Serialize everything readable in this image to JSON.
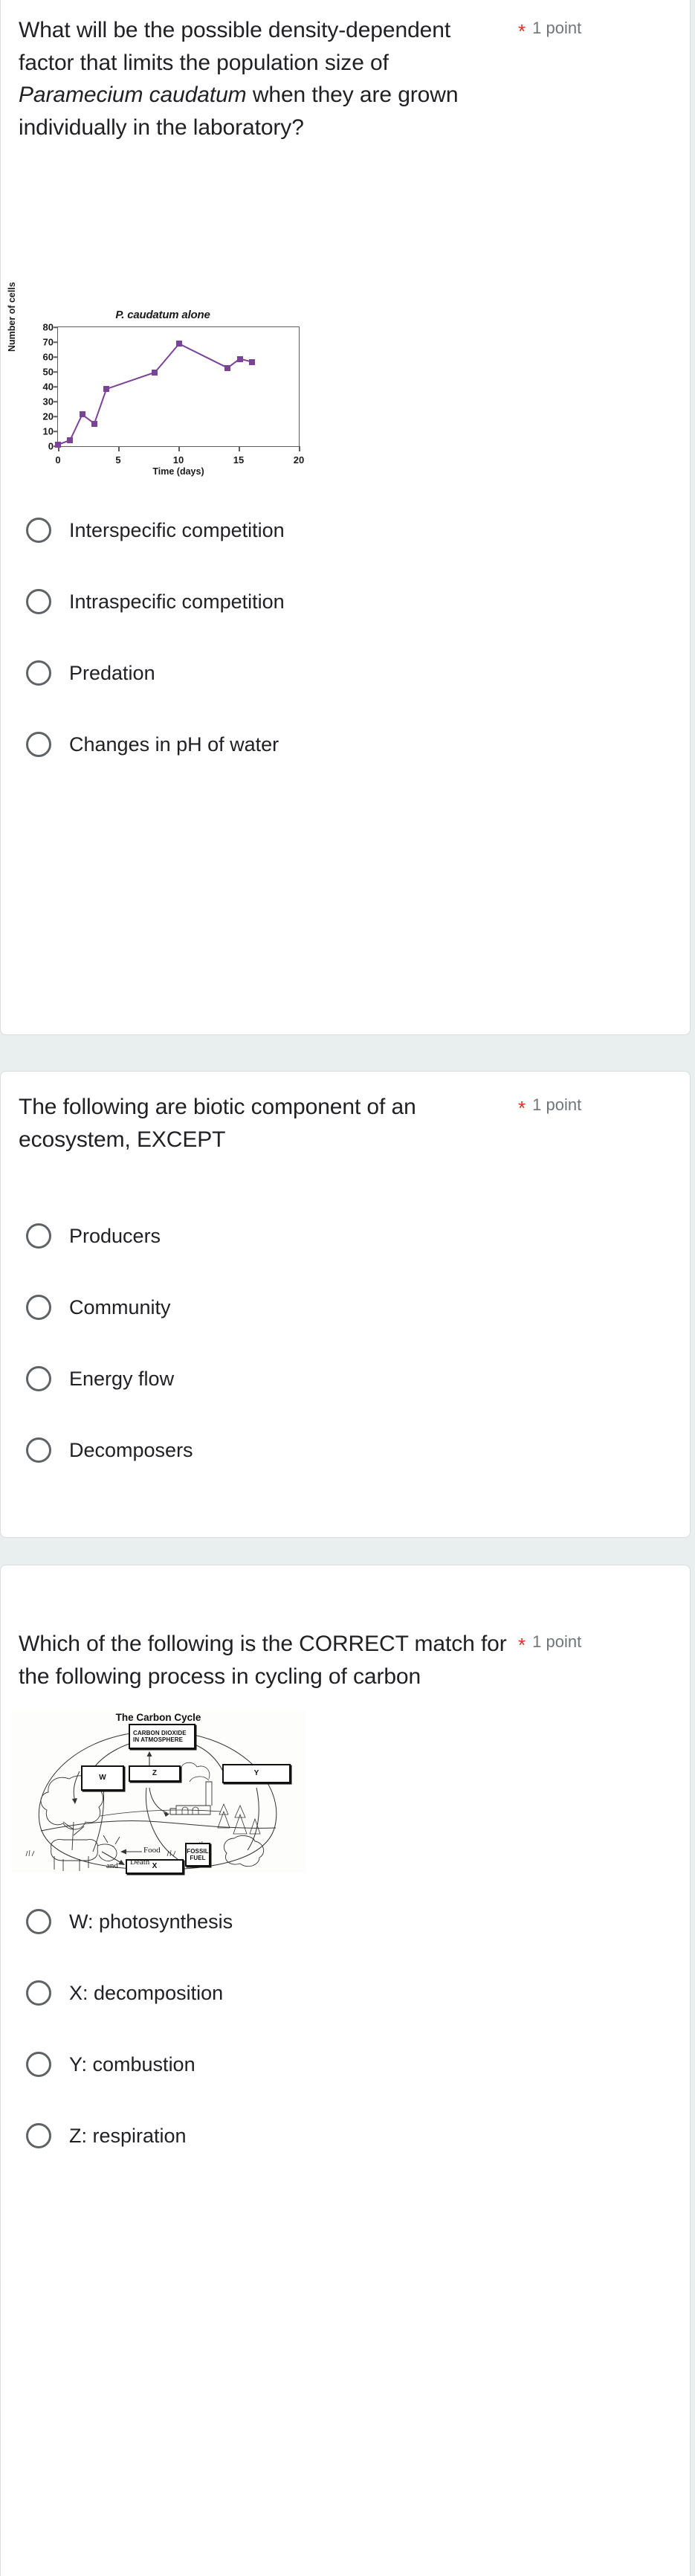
{
  "form": {
    "background_color": "#e9efee",
    "card_color": "#ffffff",
    "required_marker": "*",
    "points_label": "1 point",
    "accent_required_color": "#d93025"
  },
  "questions": [
    {
      "id": "q1",
      "text_parts": [
        {
          "t": "What will be the possible density-dependent factor that limits the population size of ",
          "i": false
        },
        {
          "t": "Paramecium caudatum",
          "i": true
        },
        {
          "t": " when they are grown individually in the laboratory?",
          "i": false
        }
      ],
      "plain_text": "What will be the possible density-dependent factor that limits the population size of Paramecium caudatum when they are grown individually in the laboratory?",
      "required": "*",
      "points": "1 point",
      "options": [
        "Interspecific competition",
        "Intraspecific competition",
        "Predation",
        "Changes in pH of water"
      ]
    },
    {
      "id": "q2",
      "plain_text": "The following are biotic component of an ecosystem, EXCEPT",
      "required": "*",
      "points": "1 point",
      "options": [
        "Producers",
        "Community",
        "Energy flow",
        "Decomposers"
      ]
    },
    {
      "id": "q3",
      "plain_text": "Which of the following is the CORRECT match for the following process in cycling of carbon",
      "required": "*",
      "points": "1 point",
      "options": [
        "W: photosynthesis",
        "X: decomposition",
        "Y: combustion",
        "Z: respiration"
      ]
    }
  ],
  "chart_data": {
    "type": "line",
    "title": "P. caudatum alone",
    "title_italic_part": "P. caudatum",
    "xlabel": "Time (days)",
    "ylabel": "Number of cells",
    "xlim": [
      0,
      20
    ],
    "ylim": [
      0,
      80
    ],
    "xticks": [
      0,
      5,
      10,
      15,
      20
    ],
    "yticks": [
      0,
      10,
      20,
      30,
      40,
      50,
      60,
      70,
      80
    ],
    "grid": false,
    "legend": "none",
    "series_color": "#7b4397",
    "marker": "square",
    "series": [
      {
        "name": "P. caudatum alone",
        "x": [
          0,
          1,
          2,
          3,
          4,
          8,
          10,
          14,
          15,
          16
        ],
        "y": [
          2,
          5,
          22,
          16,
          39,
          50,
          69,
          53,
          59,
          57
        ]
      }
    ]
  },
  "diagram": {
    "title": "The Carbon Cycle",
    "boxes": [
      {
        "key": "atmosphere",
        "label": "CARBON DIOXIDE IN ATMOSPHERE"
      },
      {
        "key": "w",
        "label": "W"
      },
      {
        "key": "z",
        "label": "Z"
      },
      {
        "key": "y",
        "label": "Y"
      },
      {
        "key": "fossil",
        "label": "FOSSIL FUEL"
      },
      {
        "key": "x",
        "label": "X"
      }
    ],
    "labels": [
      {
        "key": "food",
        "label": "Food"
      },
      {
        "key": "death",
        "label": "Death"
      },
      {
        "key": "and",
        "label": "and"
      }
    ]
  }
}
